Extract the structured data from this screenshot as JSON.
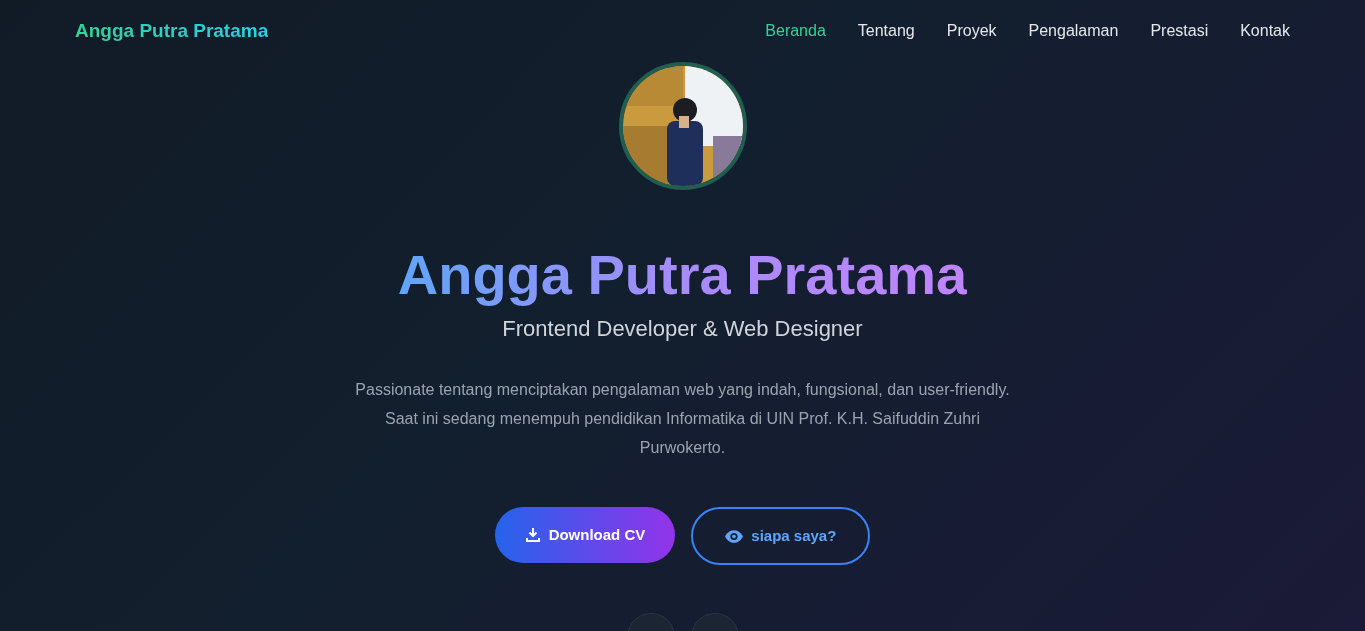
{
  "brand": "Angga Putra Pratama",
  "nav": [
    {
      "label": "Beranda",
      "selected": true
    },
    {
      "label": "Tentang",
      "selected": false
    },
    {
      "label": "Proyek",
      "selected": false
    },
    {
      "label": "Pengalaman",
      "selected": false
    },
    {
      "label": "Prestasi",
      "selected": false
    },
    {
      "label": "Kontak",
      "selected": false
    }
  ],
  "hero": {
    "name": "Angga Putra Pratama",
    "role": "Frontend Developer & Web Designer",
    "bio": "Passionate tentang menciptakan pengalaman web yang indah, fungsional, dan user-friendly. Saat ini sedang menempuh pendidikan Informatika di UIN Prof. K.H. Saifuddin Zuhri Purwokerto.",
    "buttons": [
      {
        "label": "Download CV",
        "kind": "primary"
      },
      {
        "label": "siapa saya?",
        "kind": "outline"
      }
    ]
  }
}
